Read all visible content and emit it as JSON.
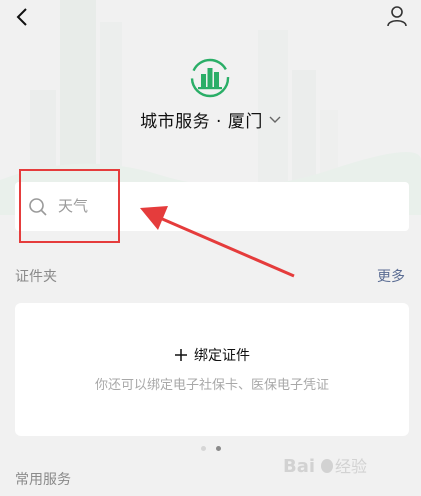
{
  "header": {
    "back_icon": "chevron-left-icon",
    "profile_icon": "person-icon"
  },
  "city": {
    "title": "城市服务 · 厦门",
    "logo_icon": "city-buildings-icon",
    "dropdown_icon": "chevron-down-icon",
    "brand_color": "#2aae67"
  },
  "search": {
    "placeholder": "天气",
    "icon": "search-icon"
  },
  "annotation": {
    "highlight_color": "#e53c3c"
  },
  "documents": {
    "title": "证件夹",
    "more_label": "更多",
    "card": {
      "action_label": "绑定证件",
      "description": "你还可以绑定电子社保卡、医保电子凭证"
    },
    "pager": {
      "count": 2,
      "active_index": 1
    }
  },
  "common_services": {
    "title": "常用服务"
  },
  "watermark": {
    "text": "Baidu 经验"
  }
}
